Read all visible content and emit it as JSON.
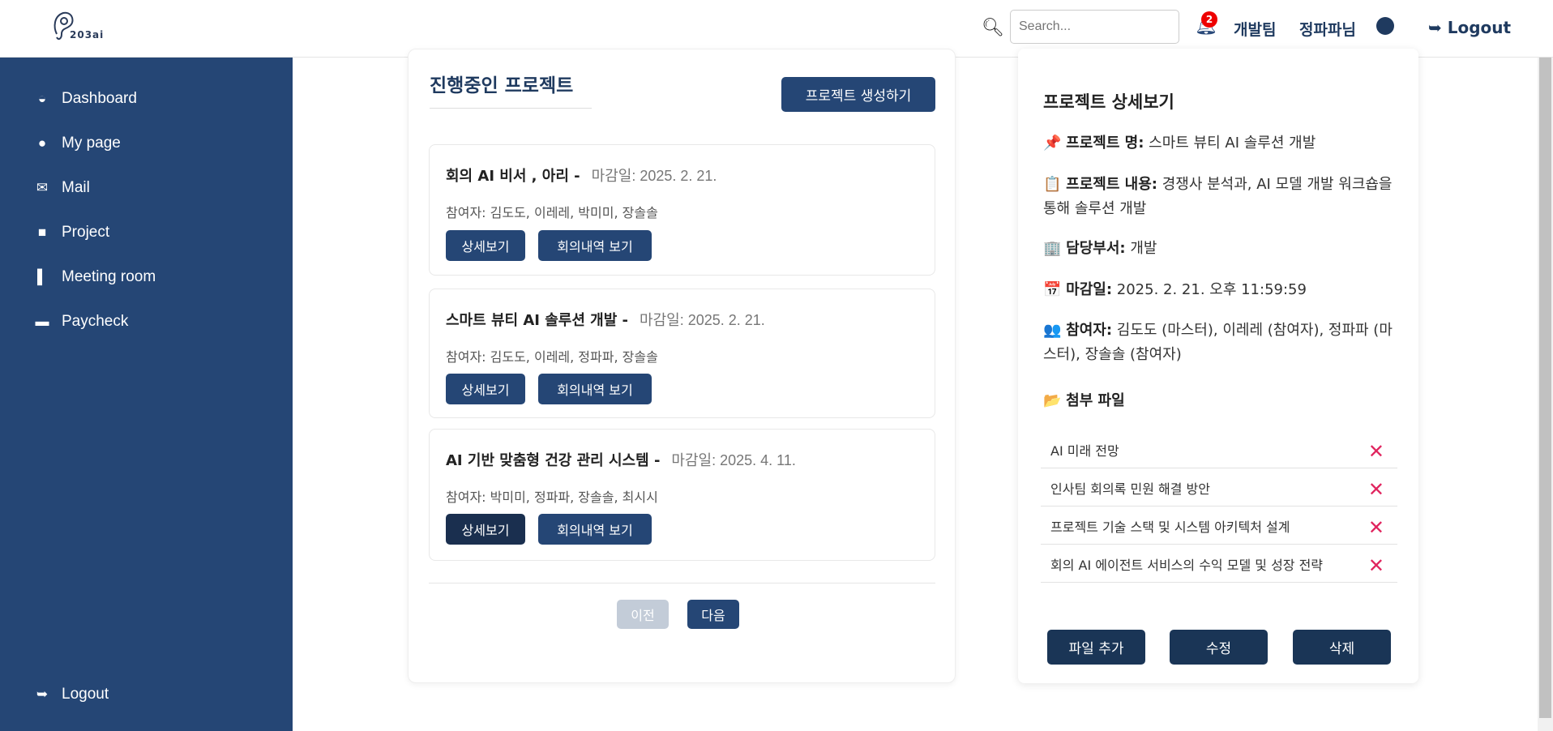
{
  "header": {
    "logo_text": "203ai",
    "search_placeholder": "Search...",
    "notification_count": "2",
    "team": "개발팀",
    "user": "정파파님",
    "logout": "Logout"
  },
  "sidebar": {
    "items": [
      {
        "label": "Dashboard",
        "icon": "dashboard-icon"
      },
      {
        "label": "My page",
        "icon": "user-icon"
      },
      {
        "label": "Mail",
        "icon": "mail-icon"
      },
      {
        "label": "Project",
        "icon": "project-icon"
      },
      {
        "label": "Meeting room",
        "icon": "door-icon"
      },
      {
        "label": "Paycheck",
        "icon": "paycheck-icon"
      }
    ],
    "logout": "Logout"
  },
  "main": {
    "title": "진행중인 프로젝트",
    "create_button": "프로젝트 생성하기",
    "projects": [
      {
        "name": "회의 AI 비서 , 아리 -",
        "deadline": "마감일: 2025. 2. 21.",
        "members": "참여자: 김도도, 이레레, 박미미, 장솔솔",
        "detail": "상세보기",
        "minutes": "회의내역 보기"
      },
      {
        "name": "스마트 뷰티 AI 솔루션 개발 -",
        "deadline": "마감일: 2025. 2. 21.",
        "members": "참여자: 김도도, 이레레, 정파파, 장솔솔",
        "detail": "상세보기",
        "minutes": "회의내역 보기"
      },
      {
        "name": "AI 기반 맞춤형 건강 관리 시스템 -",
        "deadline": "마감일: 2025. 4. 11.",
        "members": "참여자: 박미미, 정파파, 장솔솔, 최시시",
        "detail": "상세보기",
        "minutes": "회의내역 보기"
      }
    ],
    "prev": "이전",
    "next": "다음"
  },
  "detail": {
    "title": "프로젝트 상세보기",
    "name_label": "프로젝트 명:",
    "name": "스마트 뷰티 AI 솔루션 개발",
    "content_label": "프로젝트 내용:",
    "content": "경쟁사 분석과, AI 모델 개발 워크숍을 통해 솔루션 개발",
    "dept_label": "담당부서:",
    "dept": "개발",
    "deadline_label": "마감일:",
    "deadline": "2025. 2. 21. 오후 11:59:59",
    "members_label": "참여자:",
    "members": "김도도 (마스터), 이레레 (참여자), 정파파 (마스터), 장솔솔 (참여자)",
    "files_label": "첨부 파일",
    "files": [
      "AI 미래 전망",
      "인사팀 회의록 민원 해결 방안",
      "프로젝트 기술 스택 및 시스템 아키텍처 설계",
      "회의 AI 에이전트 서비스의 수익 모델 및 성장 전략"
    ],
    "add_file": "파일 추가",
    "edit": "수정",
    "delete": "삭제"
  }
}
